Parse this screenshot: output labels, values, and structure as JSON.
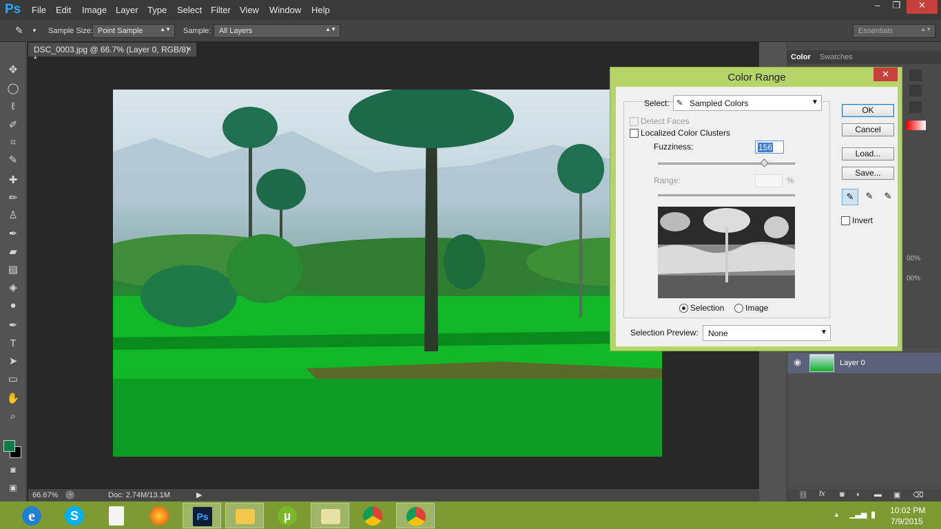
{
  "app": {
    "logo": "Ps"
  },
  "menu": [
    "File",
    "Edit",
    "Image",
    "Layer",
    "Type",
    "Select",
    "Filter",
    "View",
    "Window",
    "Help"
  ],
  "window_controls": [
    "–",
    "❐",
    "✕"
  ],
  "options": {
    "sample_size_label": "Sample Size:",
    "sample_size_value": "Point Sample",
    "sample_label": "Sample:",
    "sample_value": "All Layers",
    "workspace": "Essentials"
  },
  "document": {
    "tab_title": "DSC_0003.jpg @ 66.7% (Layer 0, RGB/8) *",
    "tab_close": "×",
    "zoom": "66.67%",
    "doc_info": "Doc: 2.74M/13.1M"
  },
  "panels": {
    "tabs": [
      "Color",
      "Swatches"
    ],
    "zoom_a": "00%",
    "zoom_b": "00%",
    "layer_name": "Layer 0"
  },
  "dialog": {
    "title": "Color Range",
    "close": "✕",
    "select_label": "Select:",
    "select_value": "Sampled Colors",
    "detect_faces": "Detect Faces",
    "localized": "Localized Color Clusters",
    "fuzziness_label": "Fuzziness:",
    "fuzziness_value": "156",
    "range_label": "Range:",
    "range_unit": "%",
    "radio_selection": "Selection",
    "radio_image": "Image",
    "preview_label": "Selection Preview:",
    "preview_value": "None",
    "ok": "OK",
    "cancel": "Cancel",
    "load": "Load...",
    "save": "Save...",
    "invert": "Invert",
    "fuzziness_fraction": 0.78
  },
  "taskbar": {
    "time": "10:02 PM",
    "date": "7/9/2015",
    "apps": [
      "internet-explorer-icon",
      "skype-icon",
      "file-icon",
      "firefox-icon",
      "photoshop-icon",
      "file-explorer-icon",
      "utorrent-icon",
      "folder-icon",
      "chrome-icon",
      "chrome-icon"
    ]
  },
  "colors": {
    "accent": "#31a8ff",
    "dialog_frame": "#b5d56a",
    "taskbar": "#7e9b33",
    "foreground": "#0f7a4a",
    "background": "#000000"
  }
}
